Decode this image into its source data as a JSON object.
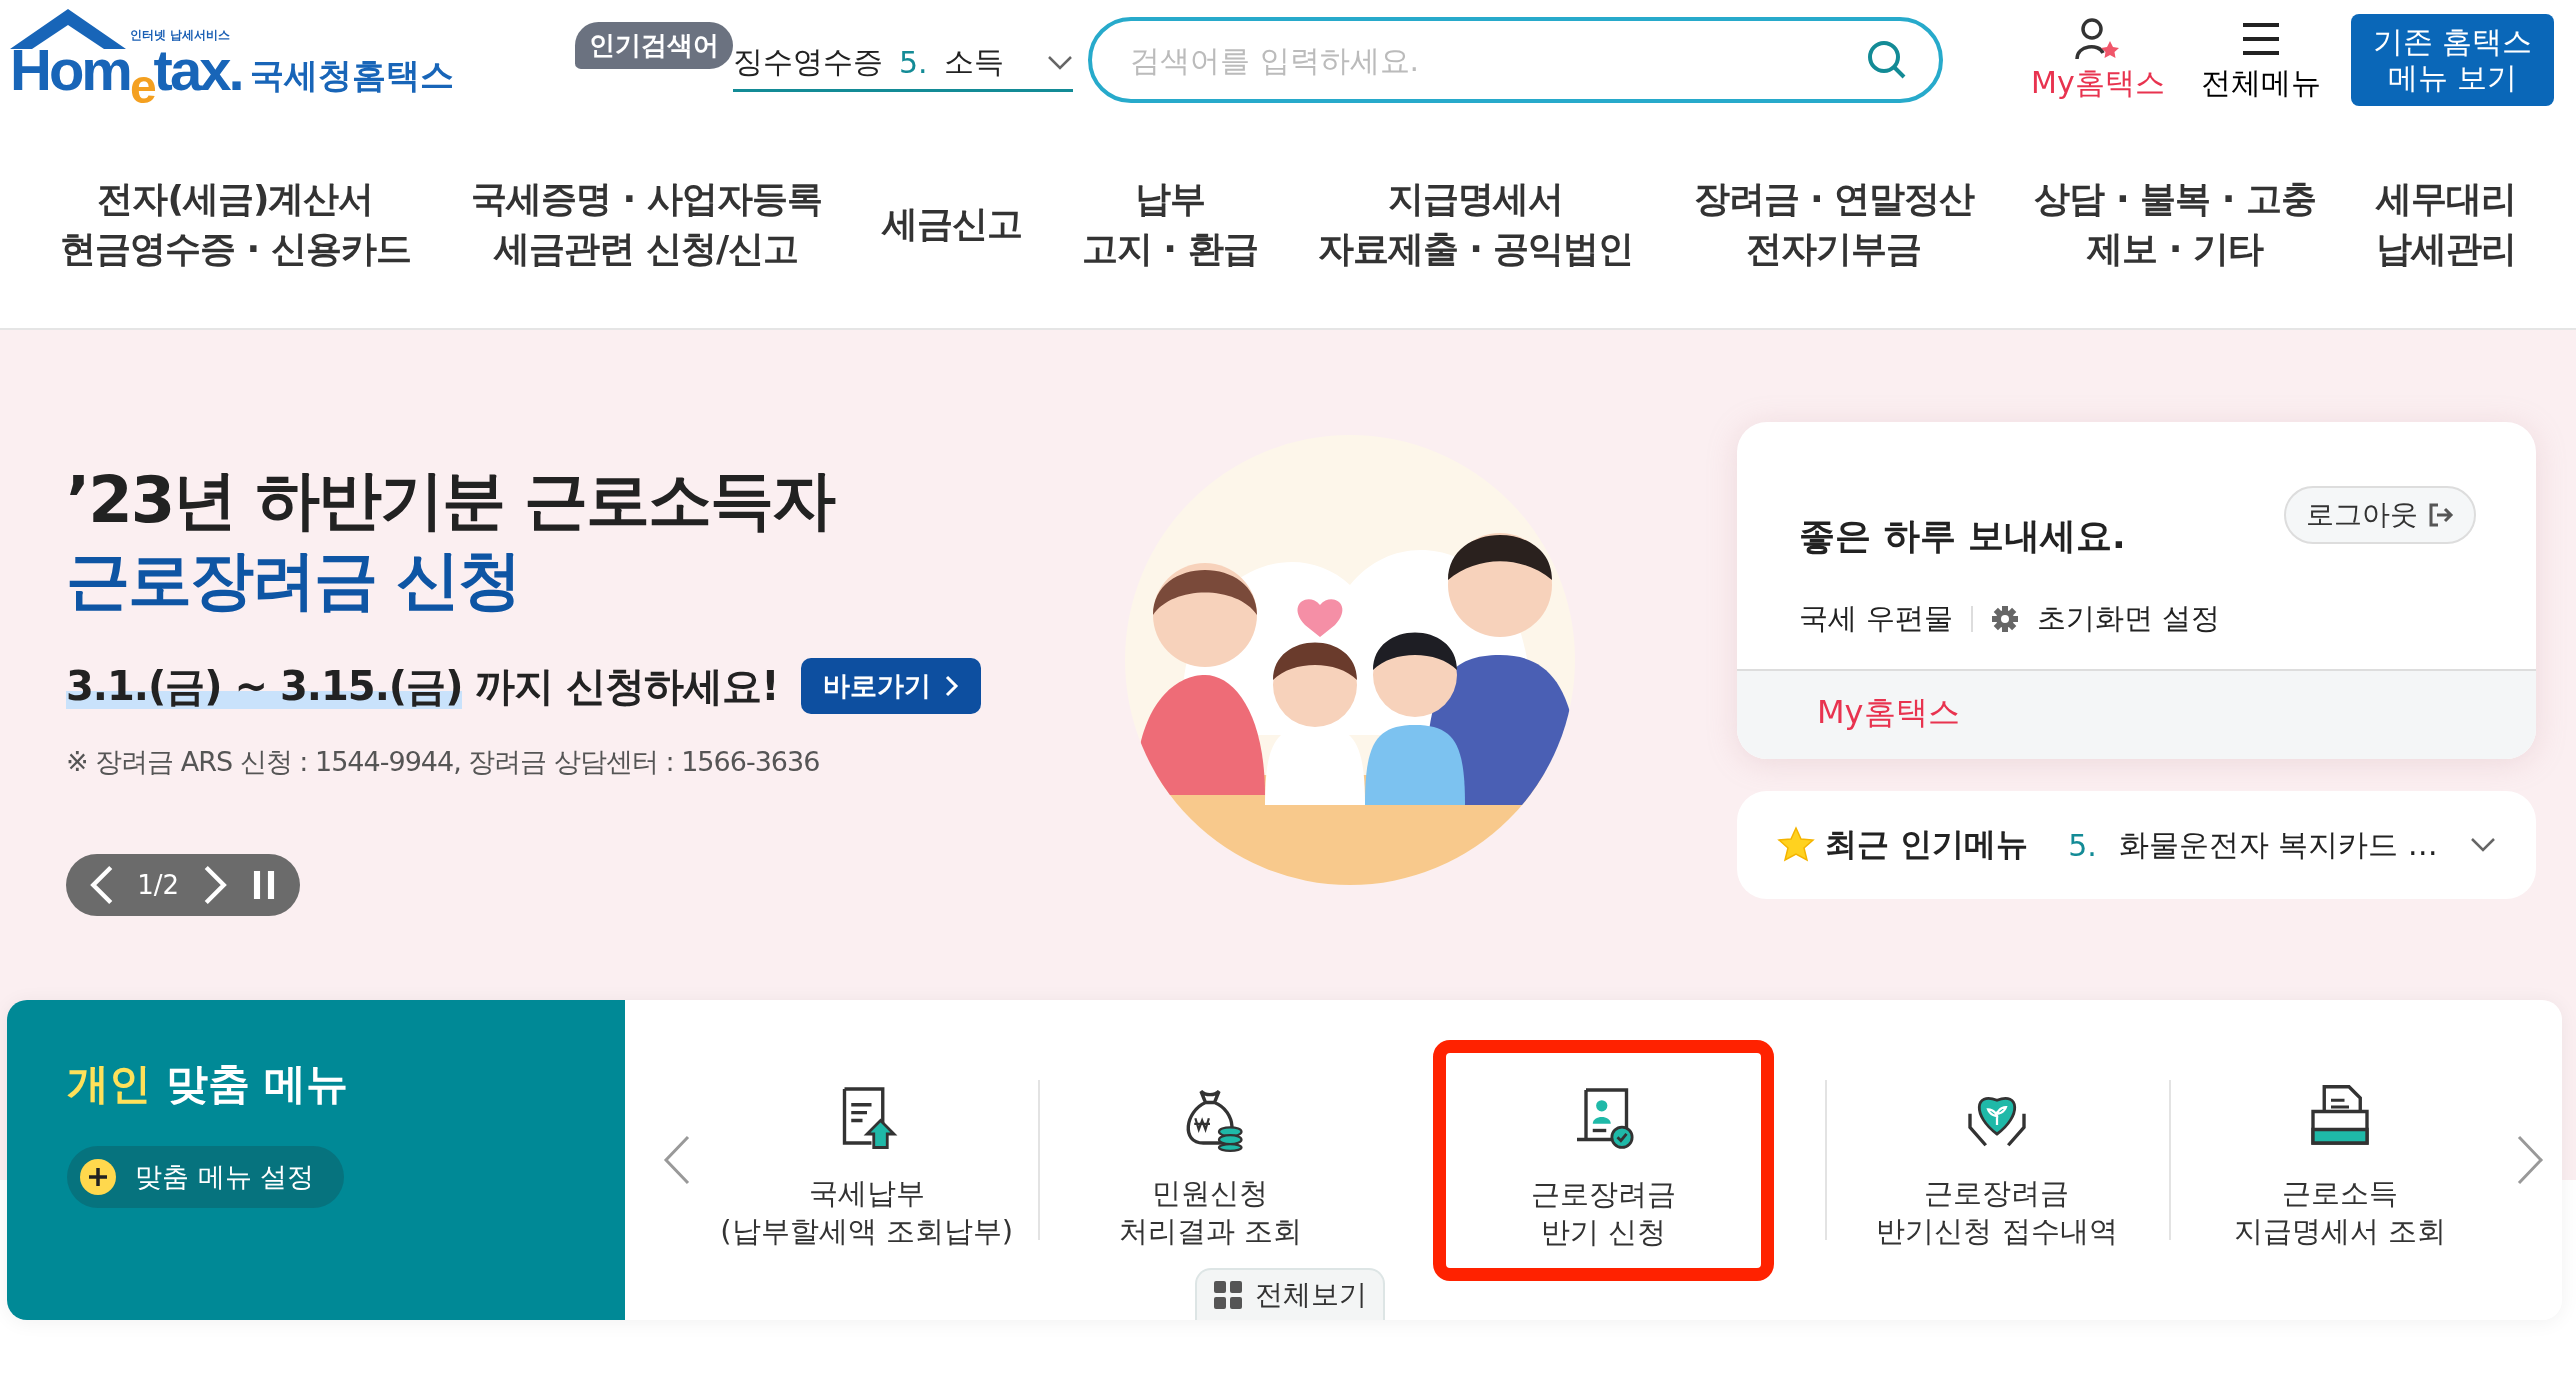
{
  "header": {
    "logo": {
      "tagline": "인터넷 납세서비스",
      "wordmark": "Hom$_{e}$tax.",
      "name": "국세청홈택스"
    },
    "popular_search": {
      "badge": "인기검색어",
      "previous": "징수영수증",
      "rank": "5.",
      "term": "소득"
    },
    "search": {
      "placeholder": "검색어를 입력하세요."
    },
    "utility": [
      {
        "kind": "my",
        "label": "My홈택스"
      },
      {
        "kind": "menu",
        "label": "전체메뉴"
      }
    ],
    "legacy_button": {
      "lines": [
        "기존 홈택스",
        "메뉴 보기"
      ]
    }
  },
  "nav": [
    {
      "lines": [
        "전자(세금)계산서",
        "현금영수증 · 신용카드"
      ]
    },
    {
      "lines": [
        "국세증명 · 사업자등록",
        "세금관련 신청/신고"
      ]
    },
    {
      "lines": [
        "세금신고"
      ]
    },
    {
      "lines": [
        "납부",
        "고지 · 환급"
      ]
    },
    {
      "lines": [
        "지급명세서",
        "자료제출 · 공익법인"
      ]
    },
    {
      "lines": [
        "장려금 · 연말정산",
        "전자기부금"
      ]
    },
    {
      "lines": [
        "상담 · 불복 · 고충",
        "제보 · 기타"
      ]
    },
    {
      "lines": [
        "세무대리",
        "납세관리"
      ]
    }
  ],
  "hero": {
    "title": "’23년 하반기분 근로소득자",
    "highlight": "근로장려금 신청",
    "period": "3.1.(금) ~ 3.15.(금)",
    "period_suffix": "까지 신청하세요!",
    "go_button": "바로가기",
    "note": "※ 장려금 ARS 신청 : 1544-9944, 장려금 상담센터 : 1566-3636",
    "pager": "1/2"
  },
  "login_card": {
    "greeting": "좋은 하루 보내세요.",
    "logout": "로그아웃",
    "links": [
      "국세 우편물",
      "초기화면 설정"
    ],
    "my": "My홈택스"
  },
  "popular_menu": {
    "title": "최근 인기메뉴",
    "rank": "5.",
    "term": "화물운전자 복지카드 …"
  },
  "custom_menu": {
    "title_accent": "개인",
    "title": "맞춤 메뉴",
    "settings_button": "맞춤 메뉴 설정",
    "items": [
      {
        "kind": "payment",
        "lines": [
          "국세납부",
          "(납부할세액 조회납부)"
        ],
        "highlighted": false
      },
      {
        "kind": "money-bag",
        "lines": [
          "민원신청",
          "처리결과 조회"
        ],
        "highlighted": false
      },
      {
        "kind": "certificate",
        "lines": [
          "근로장려금",
          "반기 신청"
        ],
        "highlighted": true
      },
      {
        "kind": "heart",
        "lines": [
          "근로장려금",
          "반기신청 접수내역"
        ],
        "highlighted": false
      },
      {
        "kind": "folder",
        "lines": [
          "근로소득",
          "지급명세서 조회"
        ],
        "highlighted": false
      }
    ],
    "view_all": "전체보기"
  }
}
